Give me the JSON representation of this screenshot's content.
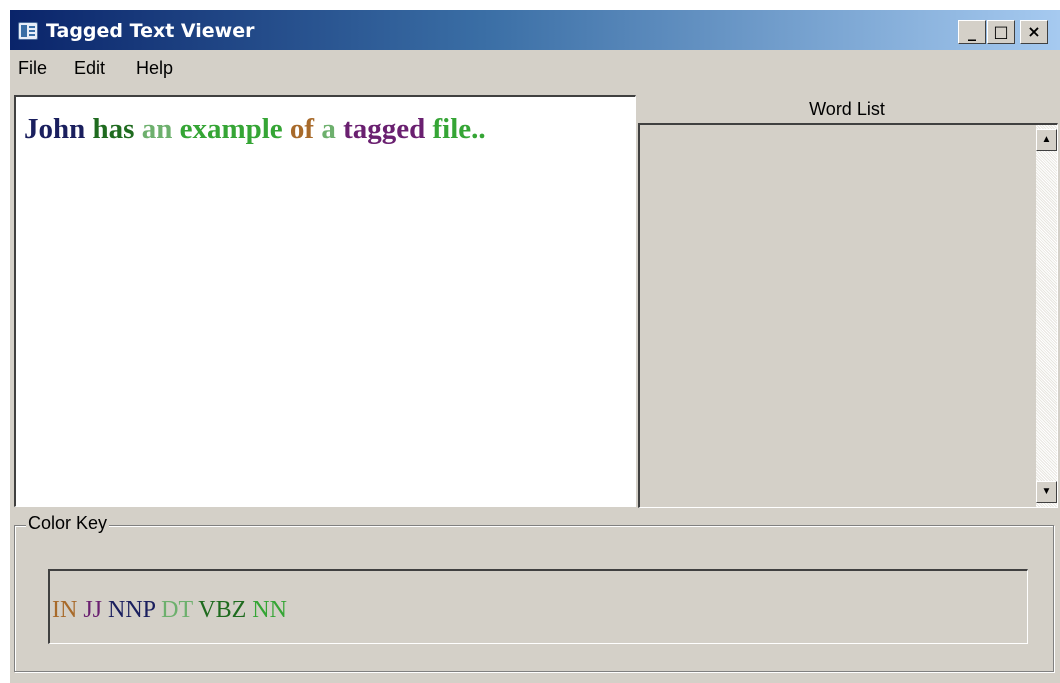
{
  "window": {
    "title": "Tagged Text Viewer",
    "minimize_glyph": "_",
    "maximize_glyph": "□",
    "close_glyph": "×"
  },
  "menu": {
    "items": [
      {
        "label": "File"
      },
      {
        "label": "Edit"
      },
      {
        "label": "Help"
      }
    ]
  },
  "editor": {
    "words": [
      {
        "text": "John",
        "color": "#1a1f5e"
      },
      {
        "text": "has",
        "color": "#1f6b1f"
      },
      {
        "text": "an",
        "color": "#6db06d"
      },
      {
        "text": "example",
        "color": "#35a535"
      },
      {
        "text": "of",
        "color": "#a86a2a"
      },
      {
        "text": "a",
        "color": "#6db06d"
      },
      {
        "text": "tagged",
        "color": "#6a2070"
      },
      {
        "text": "file..",
        "color": "#35a535"
      }
    ]
  },
  "word_list": {
    "header": "Word List",
    "scroll_up_glyph": "▲",
    "scroll_down_glyph": "▼"
  },
  "color_key": {
    "title": "Color Key",
    "tags": [
      {
        "text": "IN",
        "color": "#a86a2a"
      },
      {
        "text": "JJ",
        "color": "#6a2070"
      },
      {
        "text": "NNP",
        "color": "#1a1f5e"
      },
      {
        "text": "DT",
        "color": "#6db06d"
      },
      {
        "text": "VBZ",
        "color": "#1f6b1f"
      },
      {
        "text": "NN",
        "color": "#35a535"
      }
    ]
  }
}
